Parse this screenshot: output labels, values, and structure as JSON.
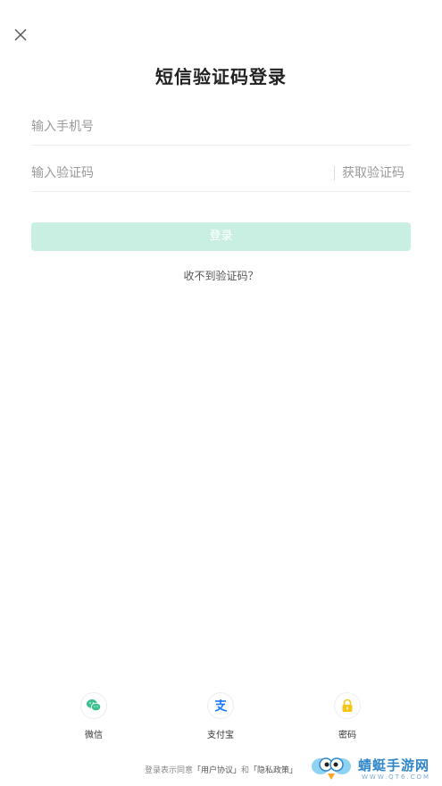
{
  "header": {
    "title": "短信验证码登录"
  },
  "form": {
    "phone_placeholder": "输入手机号",
    "code_placeholder": "输入验证码",
    "get_code_label": "获取验证码",
    "login_label": "登录",
    "no_code_label": "收不到验证码？"
  },
  "social": {
    "wechat_label": "微信",
    "alipay_label": "支付宝",
    "password_label": "密码"
  },
  "agreement": {
    "prefix": "登录表示同意",
    "user_agreement": "「用户协议」",
    "and": "和",
    "privacy_policy": "「隐私政策」"
  },
  "watermark": {
    "name": "蜻蜓手游网",
    "url": "WWW.QT6.COM"
  },
  "colors": {
    "accent": "#3cc18e",
    "login_button_disabled": "#c8efe1",
    "alipay": "#1677ff",
    "password_icon": "#f5c518"
  }
}
